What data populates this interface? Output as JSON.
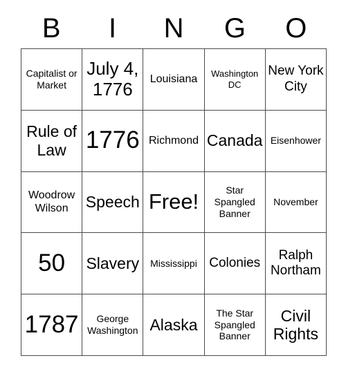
{
  "card": {
    "type": "bingo-card",
    "columns": 5,
    "rows": 5,
    "background_color": "#ffffff",
    "text_color": "#000000",
    "grid_line_color": "#4a4a4a"
  },
  "header": {
    "letters": [
      {
        "label": "B"
      },
      {
        "label": "I"
      },
      {
        "label": "N"
      },
      {
        "label": "G"
      },
      {
        "label": "O"
      }
    ]
  },
  "grid": {
    "cells": [
      {
        "text": "Capitalist or Market",
        "size": "sm",
        "row": 1,
        "col": "B",
        "free": false
      },
      {
        "text": "July 4, 1776",
        "size": "xxl",
        "row": 1,
        "col": "I",
        "free": false
      },
      {
        "text": "Louisiana",
        "size": "md",
        "row": 1,
        "col": "N",
        "free": false
      },
      {
        "text": "Washington DC",
        "size": "xs",
        "row": 1,
        "col": "G",
        "free": false
      },
      {
        "text": "New York City",
        "size": "lg",
        "row": 1,
        "col": "O",
        "free": false
      },
      {
        "text": "Rule of Law",
        "size": "xl",
        "row": 2,
        "col": "B",
        "free": false
      },
      {
        "text": "1776",
        "size": "mega",
        "row": 2,
        "col": "I",
        "free": false
      },
      {
        "text": "Richmond",
        "size": "md",
        "row": 2,
        "col": "N",
        "free": false
      },
      {
        "text": "Canada",
        "size": "xl",
        "row": 2,
        "col": "G",
        "free": false
      },
      {
        "text": "Eisenhower",
        "size": "sm",
        "row": 2,
        "col": "O",
        "free": false
      },
      {
        "text": "Woodrow Wilson",
        "size": "md",
        "row": 3,
        "col": "B",
        "free": false
      },
      {
        "text": "Speech",
        "size": "xl",
        "row": 3,
        "col": "N",
        "free": false
      },
      {
        "text": "Free!",
        "size": "huge",
        "row": 3,
        "col": "N",
        "free": true
      },
      {
        "text": "Star Spangled Banner",
        "size": "sm",
        "row": 3,
        "col": "G",
        "free": false
      },
      {
        "text": "November",
        "size": "sm",
        "row": 3,
        "col": "O",
        "free": false
      },
      {
        "text": "50",
        "size": "mega",
        "row": 4,
        "col": "B",
        "free": false
      },
      {
        "text": "Slavery",
        "size": "xl",
        "row": 4,
        "col": "I",
        "free": false
      },
      {
        "text": "Mississippi",
        "size": "sm",
        "row": 4,
        "col": "N",
        "free": false
      },
      {
        "text": "Colonies",
        "size": "lg",
        "row": 4,
        "col": "G",
        "free": false
      },
      {
        "text": "Ralph Northam",
        "size": "lg",
        "row": 4,
        "col": "O",
        "free": false
      },
      {
        "text": "1787",
        "size": "mega",
        "row": 5,
        "col": "B",
        "free": false
      },
      {
        "text": "George Washington",
        "size": "sm",
        "row": 5,
        "col": "I",
        "free": false
      },
      {
        "text": "Alaska",
        "size": "xl",
        "row": 5,
        "col": "N",
        "free": false
      },
      {
        "text": "The Star Spangled Banner",
        "size": "sm",
        "row": 5,
        "col": "G",
        "free": false
      },
      {
        "text": "Civil Rights",
        "size": "xl",
        "row": 5,
        "col": "O",
        "free": false
      }
    ]
  }
}
